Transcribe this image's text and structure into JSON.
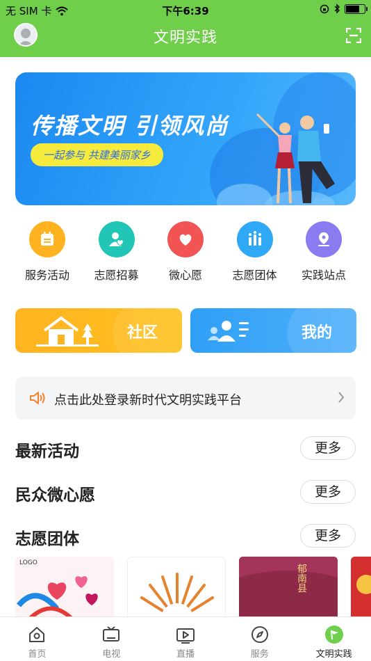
{
  "status_bar": {
    "carrier": "无 SIM 卡",
    "time": "下午6:39",
    "battery_level": 0.75
  },
  "header": {
    "title": "文明实践",
    "left_icon": "avatar",
    "right_icon": "scan-icon",
    "color": "#6fce4a"
  },
  "banner": {
    "headline": "传播文明 引领风尚",
    "slogan": "一起参与 共建美丽家乡"
  },
  "quick_actions": [
    {
      "label": "服务活动",
      "icon": "calendar-icon",
      "color": "#ffb320"
    },
    {
      "label": "志愿招募",
      "icon": "user-heart-icon",
      "color": "#22c6b6"
    },
    {
      "label": "微心愿",
      "icon": "heart-icon",
      "color": "#f25454"
    },
    {
      "label": "志愿团体",
      "icon": "group-icon",
      "color": "#2fa8f5"
    },
    {
      "label": "实践站点",
      "icon": "location-icon",
      "color": "#8b7bf0"
    }
  ],
  "tiles": {
    "community": {
      "label": "社区",
      "icon": "house-icon"
    },
    "mine": {
      "label": "我的",
      "icon": "user-card-icon"
    }
  },
  "notice": {
    "text": "点击此处登录新时代文明实践平台",
    "icon": "speaker-icon"
  },
  "sections": [
    {
      "title": "最新活动",
      "more": "更多"
    },
    {
      "title": "民众微心愿",
      "more": "更多"
    },
    {
      "title": "志愿团体",
      "more": "更多"
    }
  ],
  "thumbnails": [
    {
      "caption": "LOGO"
    },
    {
      "caption": ""
    },
    {
      "caption": "郁南县"
    },
    {
      "caption": ""
    }
  ],
  "tabbar": [
    {
      "label": "首页",
      "icon": "home-icon",
      "active": false
    },
    {
      "label": "电视",
      "icon": "tv-icon",
      "active": false
    },
    {
      "label": "直播",
      "icon": "live-icon",
      "active": false
    },
    {
      "label": "服务",
      "icon": "compass-icon",
      "active": false
    },
    {
      "label": "文明实践",
      "icon": "flag-icon",
      "active": true
    }
  ]
}
